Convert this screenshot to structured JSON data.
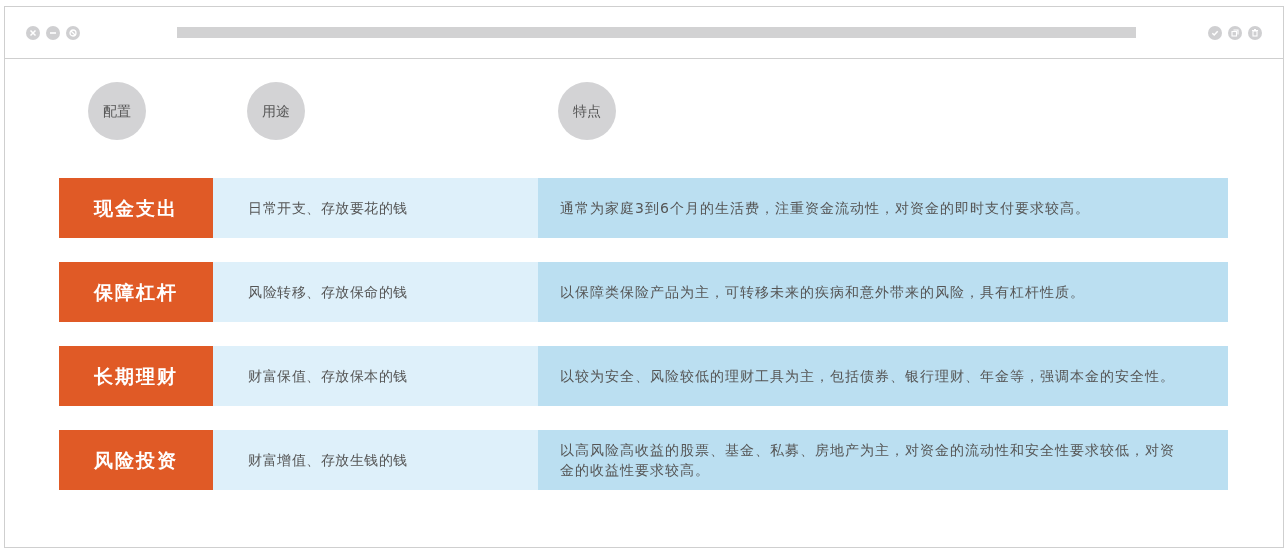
{
  "headers": [
    "配置",
    "用途",
    "特点"
  ],
  "rows": [
    {
      "name": "现金支出",
      "use": "日常开支、存放要花的钱",
      "feature": "通常为家庭3到6个月的生活费，注重资金流动性，对资金的即时支付要求较高。"
    },
    {
      "name": "保障杠杆",
      "use": "风险转移、存放保命的钱",
      "feature": "以保障类保险产品为主，可转移未来的疾病和意外带来的风险，具有杠杆性质。"
    },
    {
      "name": "长期理财",
      "use": "财富保值、存放保本的钱",
      "feature": "以较为安全、风险较低的理财工具为主，包括债券、银行理财、年金等，强调本金的安全性。"
    },
    {
      "name": "风险投资",
      "use": "财富增值、存放生钱的钱",
      "feature": "以高风险高收益的股票、基金、私募、房地产为主，对资金的流动性和安全性要求较低，对资金的收益性要求较高。"
    }
  ]
}
